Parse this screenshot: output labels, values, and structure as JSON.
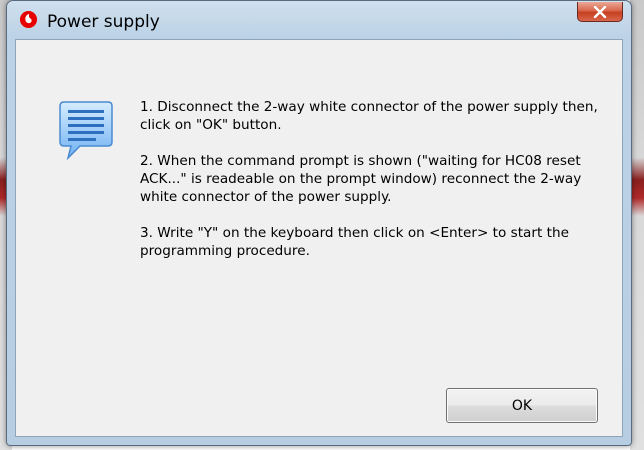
{
  "window": {
    "title": "Power supply",
    "app_icon": "red-drop-logo-icon",
    "close_icon": "close-x-icon",
    "accent_color": "#c5401f"
  },
  "dialog": {
    "icon": "message-lines-icon",
    "steps": [
      "1. Disconnect the 2-way white connector of the power supply then, click on \"OK\" button.",
      "2. When the command prompt is shown (\"waiting for HC08 reset ACK...\" is readeable on the prompt window) reconnect the 2-way white connector of the power supply.",
      "3. Write \"Y\" on the keyboard then click on <Enter> to start the programming procedure."
    ],
    "ok_label": "OK"
  }
}
